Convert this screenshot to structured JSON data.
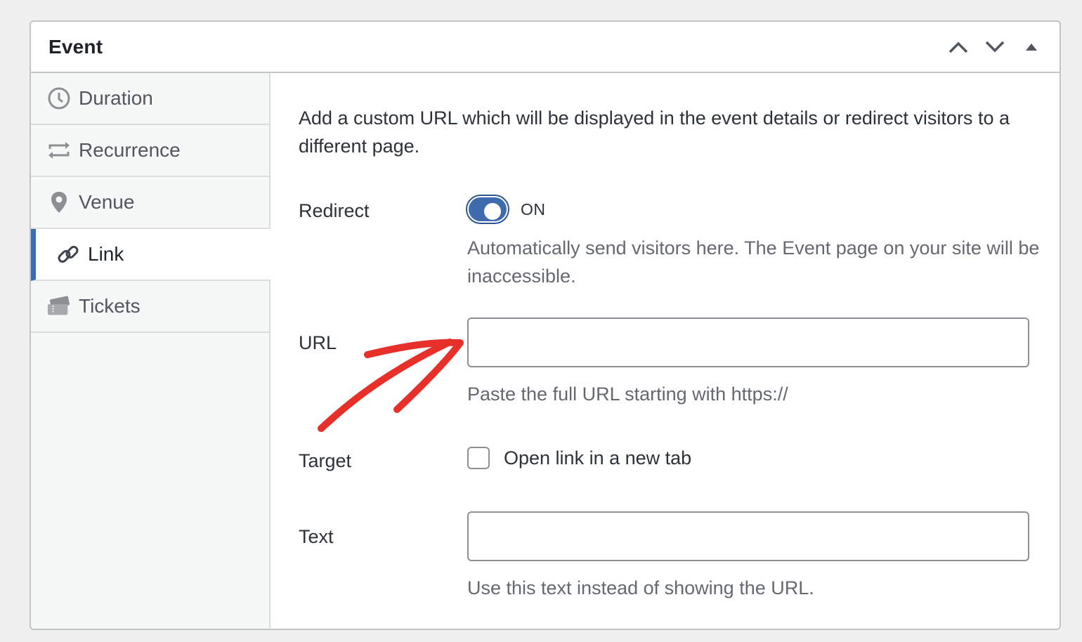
{
  "panel": {
    "title": "Event",
    "actions": {
      "move_up_icon": "chevron-up-icon",
      "move_down_icon": "chevron-down-icon",
      "toggle_icon": "triangle-up-icon"
    }
  },
  "sidebar": {
    "active_color": "#3e6bad",
    "items": [
      {
        "label": "Duration",
        "icon": "clock-icon"
      },
      {
        "label": "Recurrence",
        "icon": "repeat-icon"
      },
      {
        "label": "Venue",
        "icon": "location-pin-icon"
      },
      {
        "label": "Link",
        "icon": "link-icon",
        "active": true
      },
      {
        "label": "Tickets",
        "icon": "tickets-icon"
      }
    ]
  },
  "main": {
    "description": "Add a custom URL which will be displayed in the event details or redirect visitors to a different page.",
    "redirect": {
      "label": "Redirect",
      "state": "ON",
      "help": "Automatically send visitors here. The Event page on your site will be inaccessible."
    },
    "url": {
      "label": "URL",
      "value": "",
      "help": "Paste the full URL starting with https://"
    },
    "target": {
      "label": "Target",
      "checkbox_label": "Open link in a new tab",
      "checked": false
    },
    "text": {
      "label": "Text",
      "value": "",
      "help": "Use this text instead of showing the URL."
    }
  },
  "annotation": {
    "color": "#e8302a",
    "icon": "hand-drawn-arrow-icon"
  }
}
